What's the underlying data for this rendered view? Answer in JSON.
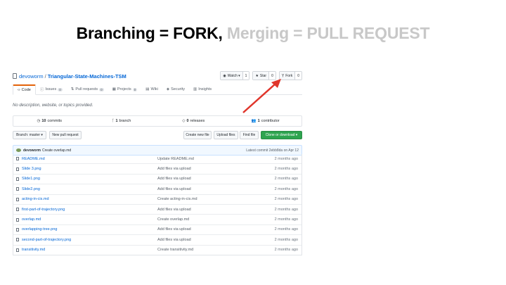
{
  "slide": {
    "title_part1": "Branching = FORK,",
    "title_part2": "Merging = PULL REQUEST"
  },
  "repo": {
    "owner": "devoworm",
    "separator": "/",
    "name": "Triangular-State-Machines-TSM",
    "description": "No description, website, or topics provided."
  },
  "actions": {
    "watch": {
      "label": "Watch ▾",
      "count": "1"
    },
    "star": {
      "label": "Star",
      "count": "0"
    },
    "fork": {
      "label": "Fork",
      "count": "0"
    }
  },
  "tabs": [
    {
      "label": "Code",
      "count": ""
    },
    {
      "label": "Issues",
      "count": "0"
    },
    {
      "label": "Pull requests",
      "count": "0"
    },
    {
      "label": "Projects",
      "count": "0"
    },
    {
      "label": "Wiki",
      "count": ""
    },
    {
      "label": "Security",
      "count": ""
    },
    {
      "label": "Insights",
      "count": ""
    }
  ],
  "stats": {
    "commits": {
      "num": "10",
      "text": "commits"
    },
    "branch": {
      "num": "1",
      "text": "branch"
    },
    "releases": {
      "num": "0",
      "text": "releases"
    },
    "contributors": {
      "num": "1",
      "text": "contributor"
    }
  },
  "toolbar": {
    "branch": "Branch: master ▾",
    "new_pr": "New pull request",
    "create_file": "Create new file",
    "upload": "Upload files",
    "find": "Find file",
    "clone": "Clone or download ▾"
  },
  "commit": {
    "user": "devoworm",
    "message": "Create overlap.md",
    "latest": "Latest commit 2ebb8da on Apr 12"
  },
  "files": [
    {
      "name": "README.md",
      "msg": "Update README.md",
      "age": "2 months ago"
    },
    {
      "name": "Slide 3.png",
      "msg": "Add files via upload",
      "age": "2 months ago"
    },
    {
      "name": "Slide1.png",
      "msg": "Add files via upload",
      "age": "2 months ago"
    },
    {
      "name": "Slide2.png",
      "msg": "Add files via upload",
      "age": "2 months ago"
    },
    {
      "name": "acting-in-cis.md",
      "msg": "Create acting-in-cis.md",
      "age": "2 months ago"
    },
    {
      "name": "first-part-of-trajectory.png",
      "msg": "Add files via upload",
      "age": "2 months ago"
    },
    {
      "name": "overlap.md",
      "msg": "Create overlap.md",
      "age": "2 months ago"
    },
    {
      "name": "overlapping-tree.png",
      "msg": "Add files via upload",
      "age": "2 months ago"
    },
    {
      "name": "second-part-of-trajectory.png",
      "msg": "Add files via upload",
      "age": "2 months ago"
    },
    {
      "name": "transitivity.md",
      "msg": "Create transitivity.md",
      "age": "2 months ago"
    }
  ],
  "colors": {
    "accent_arrow": "#e0352b",
    "link": "#0366d6",
    "clone_button": "#2ea44f"
  }
}
